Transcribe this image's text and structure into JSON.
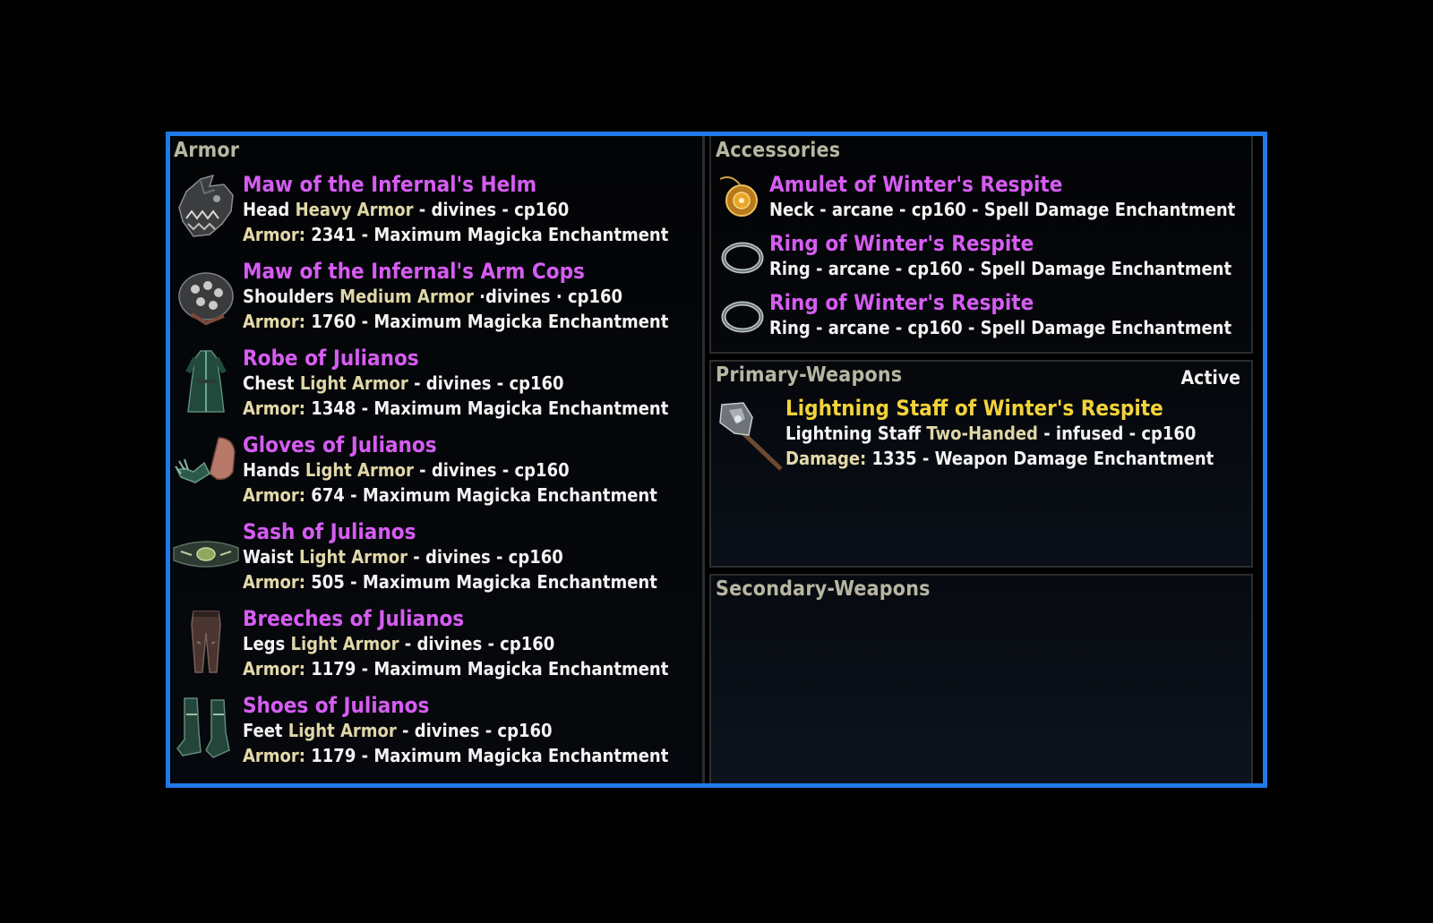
{
  "colors": {
    "frame_border": "#1f7ae8",
    "epic_name": "#d65cf2",
    "legendary_name": "#f2d33a",
    "section_title": "#b7b6a1",
    "type_text": "#e0d7a8",
    "body_text": "#f3f3f3"
  },
  "armor": {
    "title": "Armor",
    "items": [
      {
        "icon": "helm-icon",
        "name": "Maw of the Infernal's Helm",
        "slot": "Head",
        "weight": "Heavy Armor",
        "trait_cp": "- divines  - cp160",
        "stat_label": "Armor:",
        "stat_text": "2341 - Maximum Magicka Enchantment"
      },
      {
        "icon": "shoulder-icon",
        "name": "Maw of the Infernal's Arm Cops",
        "slot": "Shoulders",
        "weight": "Medium Armor",
        "trait_cp": "·divines · cp160",
        "stat_label": "Armor:",
        "stat_text": "1760 - Maximum Magicka Enchantment"
      },
      {
        "icon": "robe-icon",
        "name": "Robe of Julianos",
        "slot": "Chest",
        "weight": "Light Armor",
        "trait_cp": "- divines - cp160",
        "stat_label": "Armor:",
        "stat_text": "1348 - Maximum Magicka Enchantment"
      },
      {
        "icon": "gloves-icon",
        "name": "Gloves of Julianos",
        "slot": "Hands",
        "weight": "Light Armor",
        "trait_cp": "- divines - cp160",
        "stat_label": "Armor:",
        "stat_text": "674 - Maximum Magicka Enchantment"
      },
      {
        "icon": "sash-icon",
        "name": "Sash of Julianos",
        "slot": "Waist",
        "weight": "Light Armor",
        "trait_cp": "- divines - cp160",
        "stat_label": "Armor:",
        "stat_text": "505 - Maximum Magicka Enchantment"
      },
      {
        "icon": "breeches-icon",
        "name": "Breeches of Julianos",
        "slot": "Legs",
        "weight": "Light Armor",
        "trait_cp": "- divines - cp160",
        "stat_label": "Armor:",
        "stat_text": "1179 - Maximum Magicka Enchantment"
      },
      {
        "icon": "shoes-icon",
        "name": "Shoes of Julianos",
        "slot": "Feet",
        "weight": "Light Armor",
        "trait_cp": "- divines - cp160",
        "stat_label": "Armor:",
        "stat_text": "1179 - Maximum Magicka Enchantment"
      }
    ]
  },
  "accessories": {
    "title": "Accessories",
    "items": [
      {
        "icon": "amulet-icon",
        "name": "Amulet of Winter's Respite",
        "line": "Neck - arcane - cp160 - Spell Damage Enchantment"
      },
      {
        "icon": "ring-icon",
        "name": "Ring of Winter's Respite",
        "line": "Ring - arcane - cp160 - Spell Damage Enchantment"
      },
      {
        "icon": "ring-icon",
        "name": "Ring of Winter's Respite",
        "line": "Ring - arcane - cp160 - Spell Damage Enchantment"
      }
    ]
  },
  "primary_weapons": {
    "title": "Primary-Weapons",
    "status": "Active",
    "item": {
      "icon": "lightning-staff-icon",
      "name": "Lightning Staff of Winter's Respite",
      "type_prefix": "Lightning Staff",
      "handedness": "Two-Handed",
      "trait_cp": "- infused - cp160",
      "stat_label": "Damage:",
      "stat_text": "1335 - Weapon Damage Enchantment"
    }
  },
  "secondary_weapons": {
    "title": "Secondary-Weapons"
  }
}
